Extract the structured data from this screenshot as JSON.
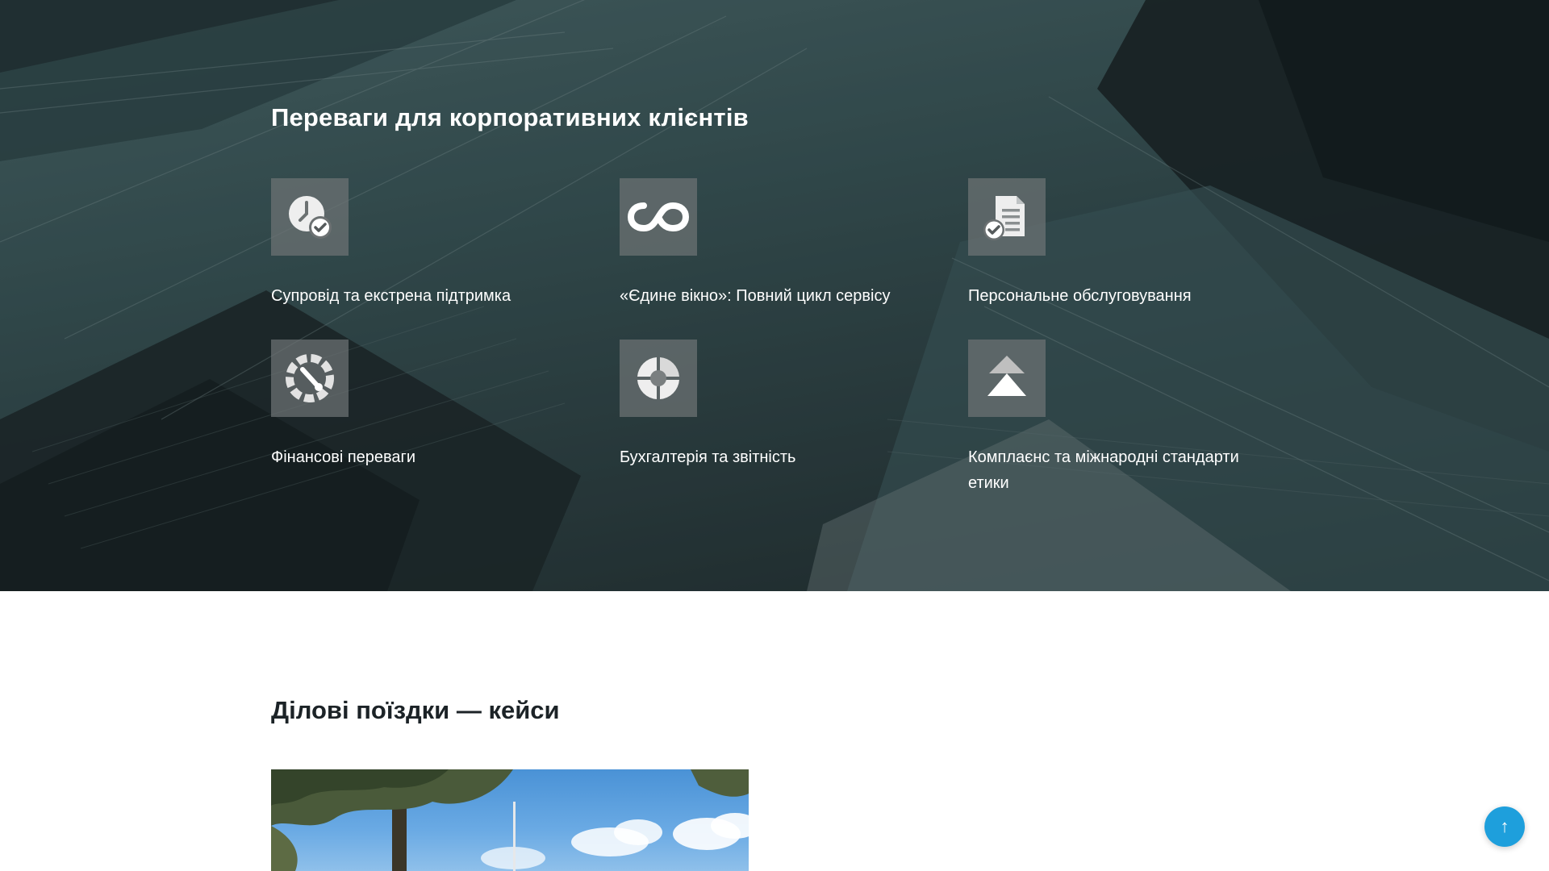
{
  "benefits_section": {
    "title": "Переваги для корпоративних клієнтів",
    "items": [
      {
        "icon": "clock-check-icon",
        "label": "Супровід та екстрена підтримка"
      },
      {
        "icon": "infinity-icon",
        "label": "«Єдине вікно»: Повний цикл сервісу"
      },
      {
        "icon": "document-check-icon",
        "label": "Персональне обслуговування"
      },
      {
        "icon": "gauge-icon",
        "label": "Фінансові переваги"
      },
      {
        "icon": "pie-chart-icon",
        "label": "Бухгалтерія та звітність"
      },
      {
        "icon": "double-chevron-up-icon",
        "label": "Комплаєнс та міжнародні стандарти етики"
      }
    ]
  },
  "cases_section": {
    "title": "Ділові поїздки — кейси"
  },
  "scroll_top": {
    "icon": "arrow-up-icon",
    "glyph": "↑"
  },
  "colors": {
    "accent": "#1e9fdc",
    "hero_text": "#ffffff",
    "heading_dark": "#1c2327"
  }
}
